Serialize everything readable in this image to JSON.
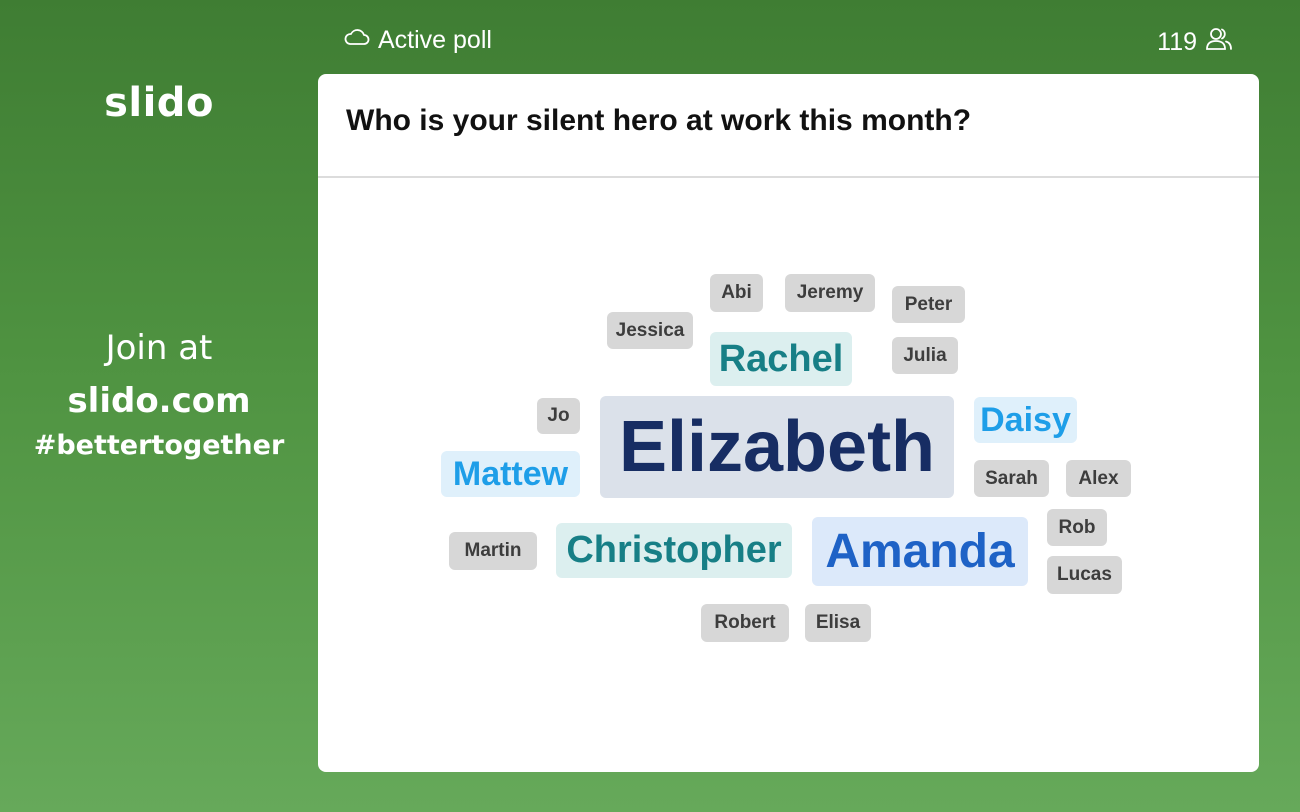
{
  "brand": {
    "logo": "slido"
  },
  "join": {
    "line1": "Join at",
    "line2": "slido.com",
    "line3": "#bettertogether"
  },
  "header": {
    "status_icon": "cloud-icon",
    "status_label": "Active poll",
    "participant_count": "119",
    "participants_icon": "users-icon"
  },
  "poll": {
    "question": "Who is your silent hero at work this month?",
    "words": [
      {
        "text": "Abi",
        "style": "gray"
      },
      {
        "text": "Jeremy",
        "style": "gray"
      },
      {
        "text": "Peter",
        "style": "gray"
      },
      {
        "text": "Jessica",
        "style": "gray"
      },
      {
        "text": "Rachel",
        "style": "teal"
      },
      {
        "text": "Julia",
        "style": "gray"
      },
      {
        "text": "Jo",
        "style": "gray"
      },
      {
        "text": "Elizabeth",
        "style": "navy"
      },
      {
        "text": "Daisy",
        "style": "light"
      },
      {
        "text": "Mattew",
        "style": "light"
      },
      {
        "text": "Sarah",
        "style": "gray"
      },
      {
        "text": "Alex",
        "style": "gray"
      },
      {
        "text": "Rob",
        "style": "gray"
      },
      {
        "text": "Martin",
        "style": "gray"
      },
      {
        "text": "Christopher",
        "style": "teal"
      },
      {
        "text": "Amanda",
        "style": "blue"
      },
      {
        "text": "Lucas",
        "style": "gray"
      },
      {
        "text": "Robert",
        "style": "gray"
      },
      {
        "text": "Elisa",
        "style": "gray"
      }
    ]
  },
  "colors": {
    "background_top": "#3f7d33",
    "background_bottom": "#66a95a",
    "navy": "#172d63",
    "blue": "#1e62c6",
    "teal": "#177f86",
    "light_blue": "#1e9ee8",
    "gray_text": "#3d3d3d"
  }
}
